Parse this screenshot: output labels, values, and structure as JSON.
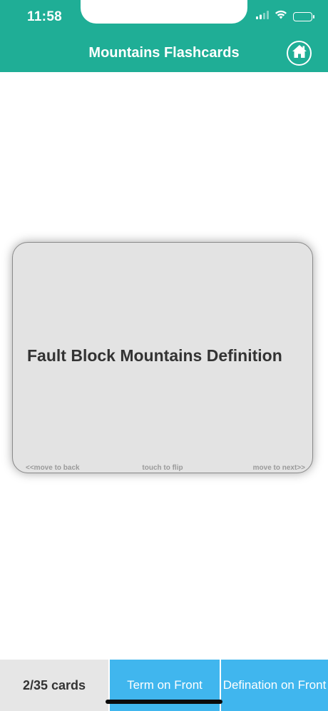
{
  "status_bar": {
    "time": "11:58",
    "icons": [
      "cellular-signal-icon",
      "wifi-icon",
      "battery-icon"
    ]
  },
  "header": {
    "title": "Mountains Flashcards",
    "home_icon": "home-icon",
    "background_color": "#1fae96"
  },
  "card": {
    "text": "Fault Block Mountains Definition",
    "hint_back": "<<move to back",
    "hint_flip": "touch to flip",
    "hint_next": "move to next>>"
  },
  "bottom_bar": {
    "count": "2/35 cards",
    "term_front": "Term on Front",
    "def_front": "Defination on Front",
    "tab_color": "#40b6ee"
  }
}
